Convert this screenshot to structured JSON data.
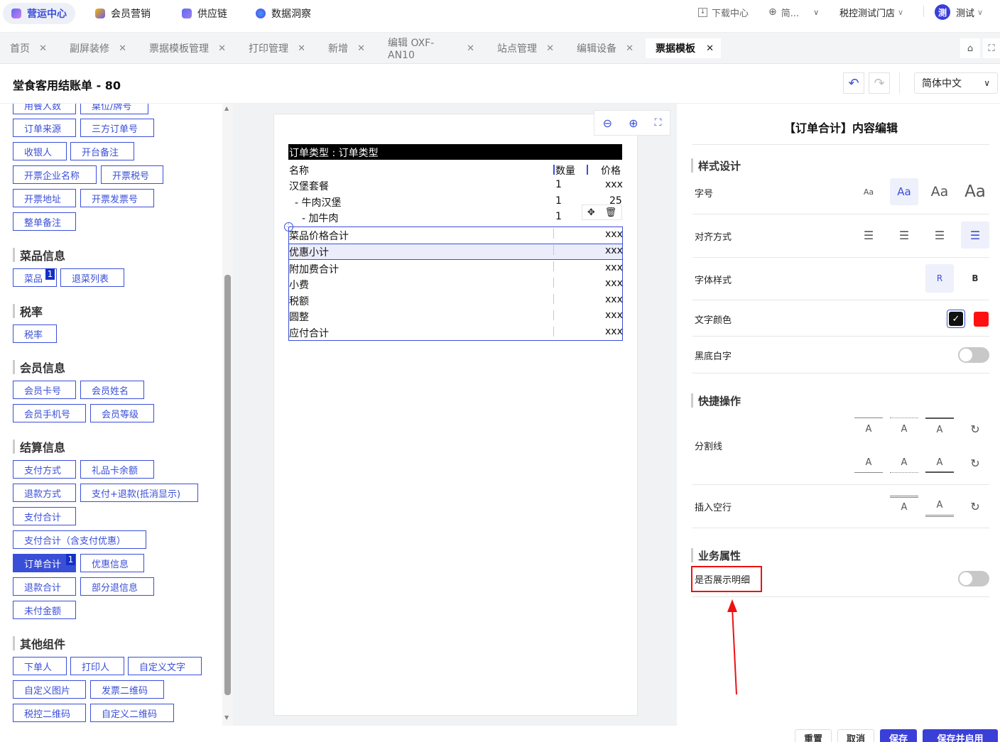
{
  "nav": {
    "apps": [
      "营运中心",
      "会员营销",
      "供应链",
      "数据洞察"
    ],
    "download": "下载中心",
    "lang_short": "简...",
    "store": "税控测试门店",
    "avatar": "测",
    "user": "测试"
  },
  "tabs": [
    "首页",
    "副屏装修",
    "票据模板管理",
    "打印管理",
    "新增",
    "编辑 OXF-AN10",
    "站点管理",
    "编辑设备",
    "票据模板"
  ],
  "header": {
    "title": "堂食客用结账单 - 80",
    "language": "简体中文"
  },
  "components": {
    "top": [
      "用餐人数",
      "桌位/牌号",
      "订单来源",
      "三方订单号",
      "收银人",
      "开台备注",
      "开票企业名称",
      "开票税号",
      "开票地址",
      "开票发票号",
      "整单备注"
    ],
    "dish_title": "菜品信息",
    "dish": [
      "菜品",
      "退菜列表"
    ],
    "dish_badge": "1",
    "tax_title": "税率",
    "tax": [
      "税率"
    ],
    "member_title": "会员信息",
    "member": [
      "会员卡号",
      "会员姓名",
      "会员手机号",
      "会员等级"
    ],
    "settle_title": "结算信息",
    "settle": [
      "支付方式",
      "礼品卡余额",
      "退款方式",
      "支付+退款(抵消显示)",
      "支付合计",
      "支付合计（含支付优惠）",
      "订单合计",
      "优惠信息",
      "退款合计",
      "部分退信息",
      "未付金额"
    ],
    "settle_badge": "1",
    "other_title": "其他组件",
    "other": [
      "下单人",
      "打印人",
      "自定义文字",
      "自定义图片",
      "发票二维码",
      "税控二维码",
      "自定义二维码"
    ]
  },
  "receipt": {
    "order_type": "订单类型 : 订单类型",
    "col_name": "名称",
    "col_qty": "数量",
    "col_price": "价格",
    "items": [
      {
        "name": "汉堡套餐",
        "qty": "1",
        "price": "xxx"
      },
      {
        "name": "- 牛肉汉堡",
        "qty": "1",
        "price": "25"
      },
      {
        "name": "- 加牛肉",
        "qty": "1",
        "price": ""
      }
    ],
    "totals": [
      {
        "name": "菜品价格合计",
        "value": "xxx"
      },
      {
        "name": "优惠小计",
        "value": "xxx"
      },
      {
        "name": "附加费合计",
        "value": "xxx"
      },
      {
        "name": "小费",
        "value": "xxx"
      },
      {
        "name": "税额",
        "value": "xxx"
      },
      {
        "name": "圆整",
        "value": "xxx"
      },
      {
        "name": "应付合计",
        "value": "xxx"
      }
    ]
  },
  "editor": {
    "title": "【订单合计】内容编辑",
    "style_title": "样式设计",
    "font_size": "字号",
    "font_size_options": [
      "Aa",
      "Aa",
      "Aa",
      "Aa"
    ],
    "align": "对齐方式",
    "font_style": "字体样式",
    "font_style_options": [
      "R",
      "B"
    ],
    "text_color": "文字颜色",
    "colors": {
      "black": "#111111",
      "red": "#ff1111",
      "accent": "#3a4fd8"
    },
    "inverse": "黑底白字",
    "quick_title": "快捷操作",
    "divider": "分割线",
    "insert_blank": "插入空行",
    "biz_title": "业务属性",
    "show_detail": "是否展示明细"
  },
  "footer": {
    "buttons": [
      "重置",
      "取消",
      "保存",
      "保存并启用"
    ]
  }
}
